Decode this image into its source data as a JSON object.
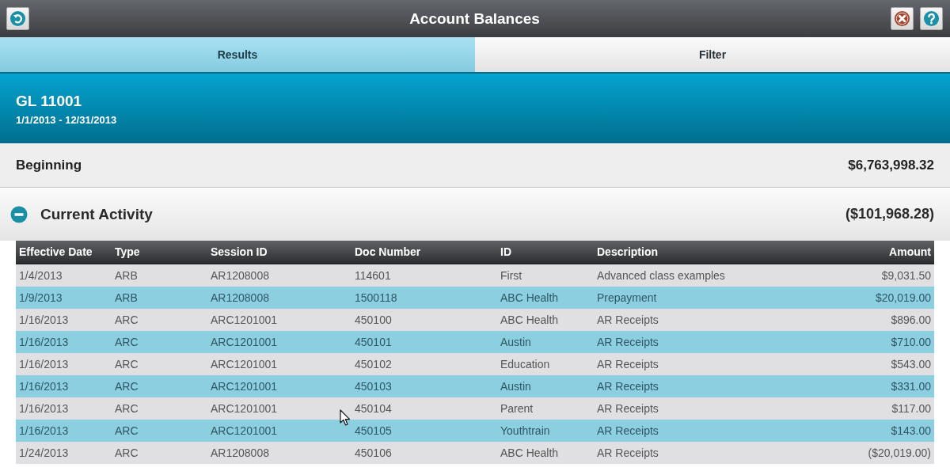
{
  "window": {
    "title": "Account Balances"
  },
  "tabs": [
    {
      "label": "Results",
      "selected": true
    },
    {
      "label": "Filter",
      "selected": false
    }
  ],
  "account": {
    "name": "GL 11001",
    "period": "1/1/2013 - 12/31/2013"
  },
  "beginning": {
    "label": "Beginning",
    "amount": "$6,763,998.32"
  },
  "current_activity": {
    "label": "Current Activity",
    "expanded": true,
    "amount": "($101,968.28)"
  },
  "table": {
    "columns": [
      "Effective Date",
      "Type",
      "Session ID",
      "Doc Number",
      "ID",
      "Description",
      "Amount"
    ],
    "rows": [
      [
        "1/4/2013",
        "ARB",
        "AR1208008",
        "114601",
        "First",
        "Advanced class examples",
        "$9,031.50"
      ],
      [
        "1/9/2013",
        "ARB",
        "AR1208008",
        "1500118",
        "ABC Health",
        "Prepayment",
        "$20,019.00"
      ],
      [
        "1/16/2013",
        "ARC",
        "ARC1201001",
        "450100",
        "ABC Health",
        "AR Receipts",
        "$896.00"
      ],
      [
        "1/16/2013",
        "ARC",
        "ARC1201001",
        "450101",
        "Austin",
        "AR Receipts",
        "$710.00"
      ],
      [
        "1/16/2013",
        "ARC",
        "ARC1201001",
        "450102",
        "Education",
        "AR Receipts",
        "$543.00"
      ],
      [
        "1/16/2013",
        "ARC",
        "ARC1201001",
        "450103",
        "Austin",
        "AR Receipts",
        "$331.00"
      ],
      [
        "1/16/2013",
        "ARC",
        "ARC1201001",
        "450104",
        "Parent",
        "AR Receipts",
        "$117.00"
      ],
      [
        "1/16/2013",
        "ARC",
        "ARC1201001",
        "450105",
        "Youthtrain",
        "AR Receipts",
        "$143.00"
      ],
      [
        "1/24/2013",
        "ARC",
        "AR1208008",
        "450106",
        "ABC Health",
        "AR Receipts",
        "($20,019.00)"
      ]
    ]
  }
}
